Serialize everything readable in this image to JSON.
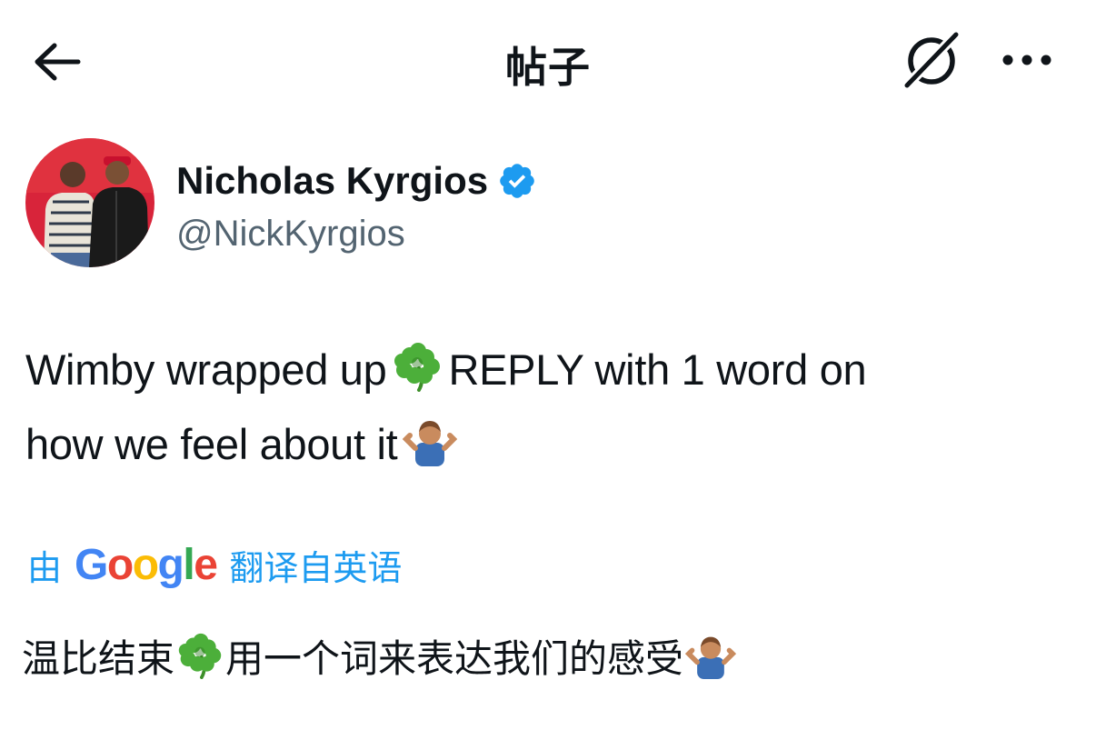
{
  "header": {
    "title": "帖子",
    "back_icon": "arrow-left-icon",
    "grok_icon": "grok-icon",
    "more_icon": "more-horizontal-icon"
  },
  "author": {
    "display_name": "Nicholas Kyrgios",
    "handle": "@NickKyrgios",
    "verified_icon": "verified-badge-icon",
    "verified_color": "#1d9bf0"
  },
  "tweet": {
    "line1_a": "Wimby wrapped up",
    "line1_b": "REPLY with 1 word on",
    "line2": "how we feel about it",
    "emoji_1": "shamrock-icon",
    "emoji_2": "person-shrugging-icon"
  },
  "translation": {
    "prefix": "由",
    "google_letters": [
      "G",
      "o",
      "o",
      "g",
      "l",
      "e"
    ],
    "google_colors": [
      "#4285f4",
      "#ea4335",
      "#fbbc05",
      "#4285f4",
      "#34a853",
      "#ea4335"
    ],
    "suffix": "翻译自英语",
    "text_a": "温比结束",
    "text_b": "用一个词来表达我们的感受"
  },
  "colors": {
    "link_blue": "#1d9bf0",
    "text_primary": "#0f1419",
    "text_secondary": "#536471"
  }
}
